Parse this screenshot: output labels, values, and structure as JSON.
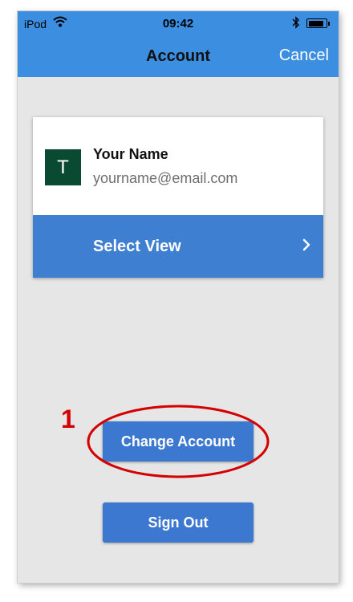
{
  "status_bar": {
    "carrier": "iPod",
    "time": "09:42",
    "battery_level": 0.9
  },
  "nav": {
    "title": "Account",
    "cancel_label": "Cancel"
  },
  "account": {
    "avatar_initial": "T",
    "name": "Your Name",
    "email": "yourname@email.com"
  },
  "select_view": {
    "label": "Select View"
  },
  "actions": {
    "change_account_label": "Change Account",
    "sign_out_label": "Sign Out"
  },
  "annotation": {
    "number": "1",
    "color": "#d40000"
  },
  "colors": {
    "nav_bar": "#3b8ee0",
    "button": "#3c78cf",
    "avatar": "#0b4a32",
    "background": "#e6e6e6"
  },
  "icons": [
    "wifi-icon",
    "bluetooth-icon",
    "battery-icon",
    "chevron-right-icon"
  ]
}
